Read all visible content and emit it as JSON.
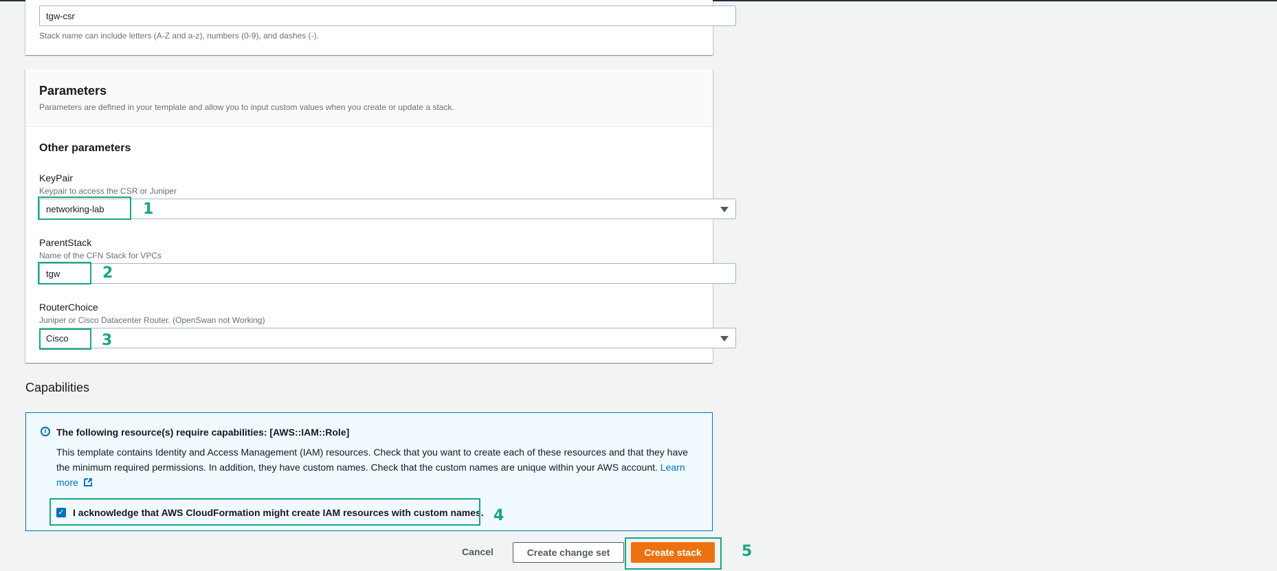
{
  "stack_name": {
    "value": "tgw-csr",
    "hint": "Stack name can include letters (A-Z and a-z), numbers (0-9), and dashes (-)."
  },
  "parameters": {
    "title": "Parameters",
    "description": "Parameters are defined in your template and allow you to input custom values when you create or update a stack.",
    "section_title": "Other parameters",
    "keypair": {
      "label": "KeyPair",
      "hint": "Keypair to access the CSR or Juniper",
      "value": "networking-lab"
    },
    "parentstack": {
      "label": "ParentStack",
      "hint": "Name of the CFN Stack for VPCs",
      "value": "tgw"
    },
    "routerchoice": {
      "label": "RouterChoice",
      "hint": "Juniper or Cisco Datacenter Router. (OpenSwan not Working)",
      "value": "Cisco"
    }
  },
  "capabilities": {
    "title": "Capabilities",
    "alert_title": "The following resource(s) require capabilities: [AWS::IAM::Role]",
    "alert_body": "This template contains Identity and Access Management (IAM) resources. Check that you want to create each of these resources and that they have the minimum required permissions. In addition, they have custom names. Check that the custom names are unique within your AWS account.",
    "learn_more": "Learn more",
    "acknowledge_label": "I acknowledge that AWS CloudFormation might create IAM resources with custom names.",
    "acknowledged": true
  },
  "actions": {
    "cancel": "Cancel",
    "create_change_set": "Create change set",
    "create_stack": "Create stack"
  },
  "annotations": [
    "1",
    "2",
    "3",
    "4",
    "5"
  ],
  "colors": {
    "highlight": "#17a589",
    "primary": "#ec7211",
    "link": "#0073bb"
  },
  "icons": {
    "info": "info-icon",
    "external": "external-link-icon",
    "dropdown": "caret-down-icon",
    "check": "checkbox-checked-icon"
  }
}
